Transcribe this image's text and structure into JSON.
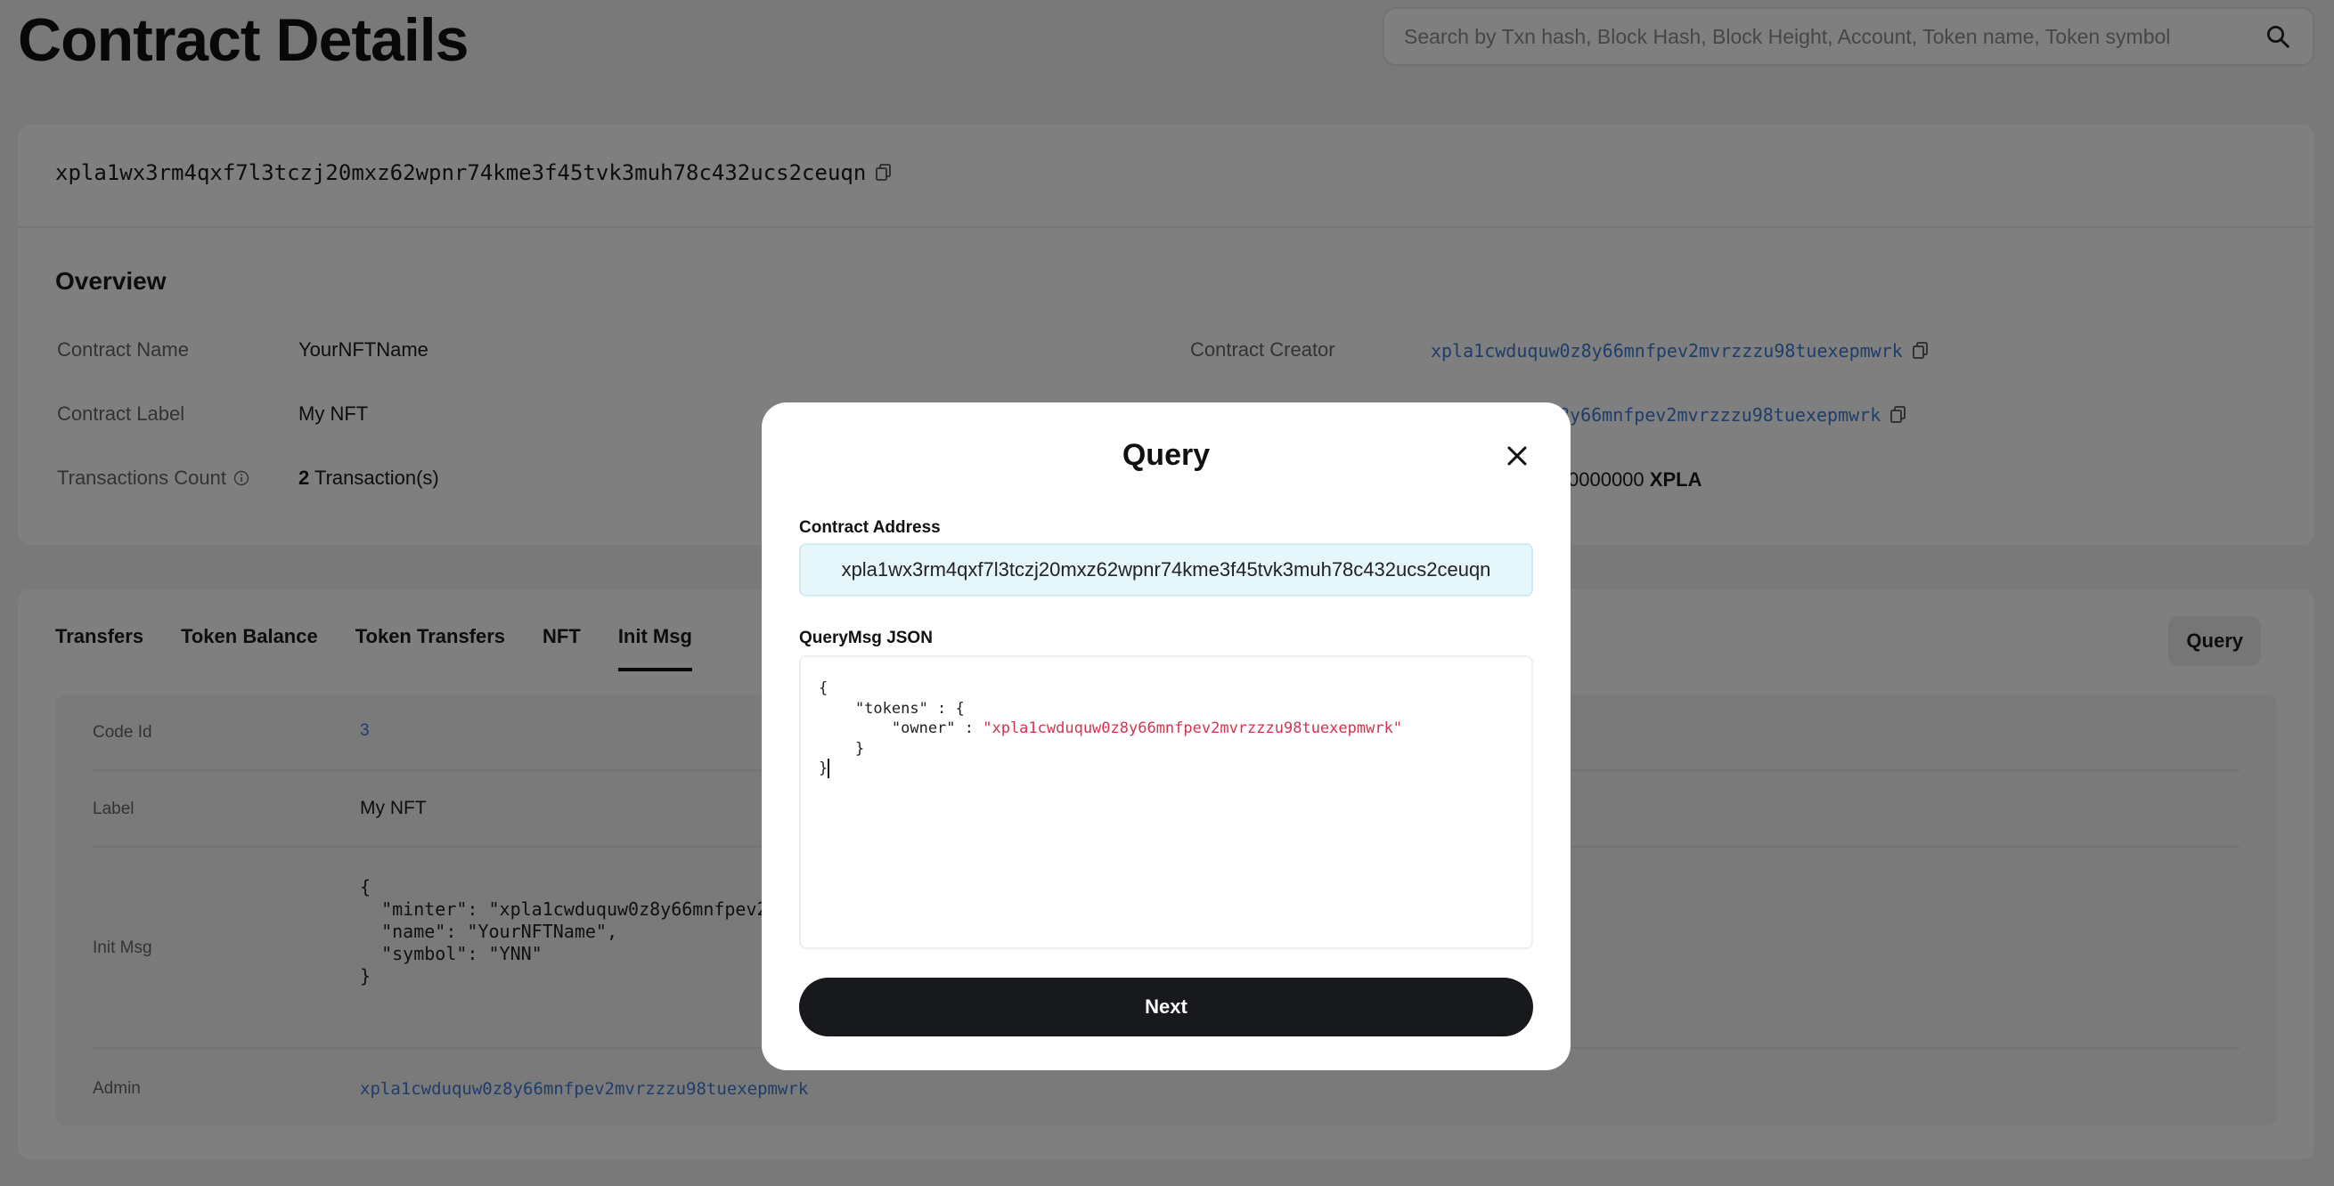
{
  "header": {
    "title": "Contract Details",
    "search_placeholder": "Search by Txn hash, Block Hash, Block Height, Account, Token name, Token symbol"
  },
  "contract": {
    "address": "xpla1wx3rm4qxf7l3tczj20mxz62wpnr74kme3f45tvk3muh78c432ucs2ceuqn"
  },
  "overview": {
    "title": "Overview",
    "name_label": "Contract Name",
    "name_value": "YourNFTName",
    "label_label": "Contract Label",
    "label_value": "My NFT",
    "tx_label": "Transactions Count",
    "tx_count": "2",
    "tx_suffix": "Transaction(s)",
    "creator_label": "Contract Creator",
    "creator_value": "xpla1cwduquw0z8y66mnfpev2mvrzzzu98tuexepmwrk",
    "admin_value_partial": "8y66mnfpev2mvrzzzu98tuexepmwrk",
    "balance_partial": "0000000",
    "balance_unit": "XPLA"
  },
  "tabs": [
    "Transfers",
    "Token Balance",
    "Token Transfers",
    "NFT",
    "Init Msg"
  ],
  "query_button": "Query",
  "init": {
    "code_id_label": "Code Id",
    "code_id_value": "3",
    "label_label": "Label",
    "label_value": "My NFT",
    "init_msg_label": "Init Msg",
    "init_msg_json": "{\n  \"minter\": \"xpla1cwduquw0z8y66mnfpev2mv\n  \"name\": \"YourNFTName\",\n  \"symbol\": \"YNN\"\n}",
    "admin_label": "Admin",
    "admin_value": "xpla1cwduquw0z8y66mnfpev2mvrzzzu98tuexepmwrk"
  },
  "modal": {
    "title": "Query",
    "address_label": "Contract Address",
    "address_value": "xpla1wx3rm4qxf7l3tczj20mxz62wpnr74kme3f45tvk3muh78c432ucs2ceuqn",
    "json_label": "QueryMsg JSON",
    "json_line1": "{",
    "json_line2": "    \"tokens\" : {",
    "json_line3_key": "        \"owner\" : ",
    "json_line3_value": "\"xpla1cwduquw0z8y66mnfpev2mvrzzzu98tuexepmwrk\"",
    "json_line4": "    }",
    "json_line5": "}",
    "next_label": "Next"
  },
  "icons": {
    "search": "search-icon",
    "copy": "copy-icon",
    "info": "info-icon",
    "close": "close-icon"
  },
  "colors": {
    "link": "#3c7ad6",
    "json_string": "#d6334f",
    "primary_button": "#18191c",
    "address_field": "#e6f7fc"
  }
}
